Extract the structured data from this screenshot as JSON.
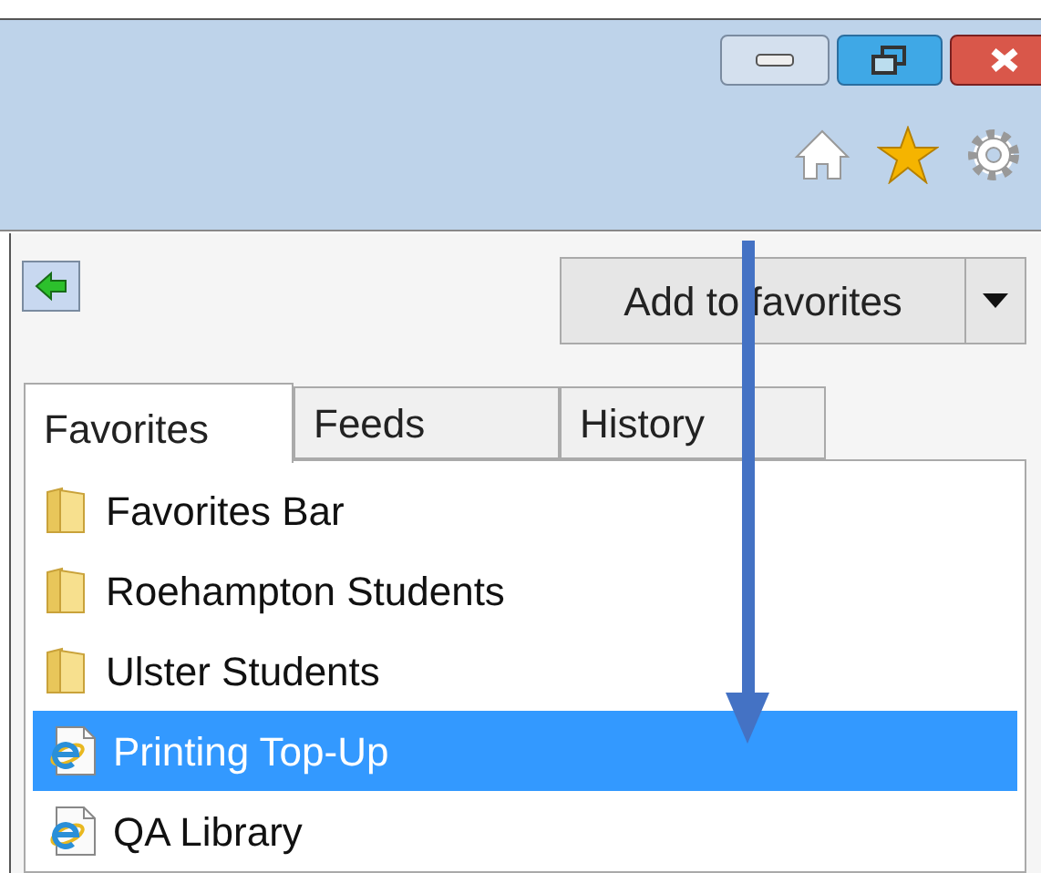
{
  "add_button": {
    "label": "Add to favorites"
  },
  "tabs": [
    {
      "label": "Favorites",
      "selected": true
    },
    {
      "label": "Feeds",
      "selected": false
    },
    {
      "label": "History",
      "selected": false
    }
  ],
  "items": [
    {
      "label": "Favorites Bar",
      "kind": "folder",
      "selected": false
    },
    {
      "label": "Roehampton Students",
      "kind": "folder",
      "selected": false
    },
    {
      "label": "Ulster Students",
      "kind": "folder",
      "selected": false
    },
    {
      "label": "Printing Top-Up",
      "kind": "page",
      "selected": true
    },
    {
      "label": "QA Library",
      "kind": "page",
      "selected": false
    }
  ]
}
